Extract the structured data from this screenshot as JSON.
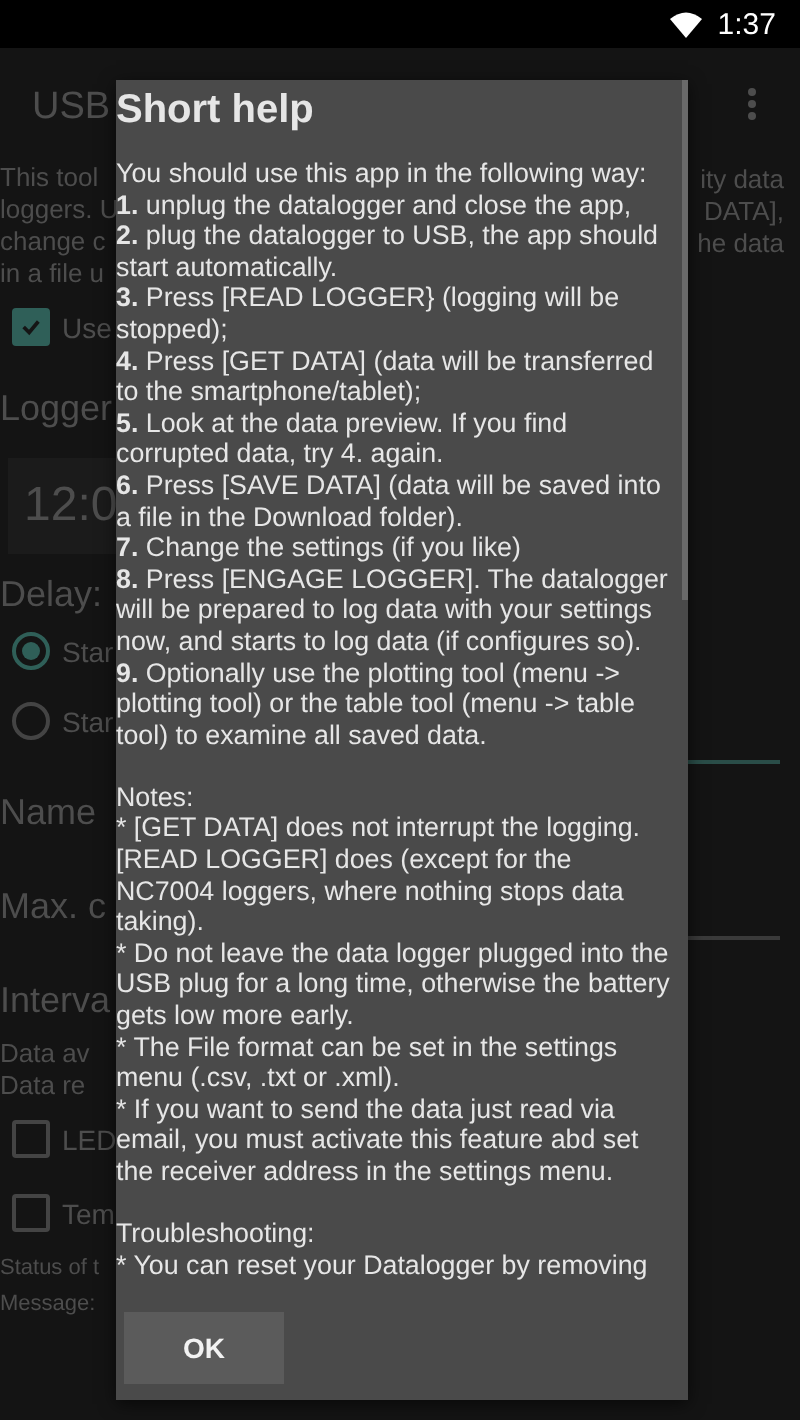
{
  "status_bar": {
    "time": "1:37"
  },
  "background": {
    "title": "USB",
    "left": [
      {
        "kind": "text",
        "text": "This tool"
      },
      {
        "kind": "text",
        "text": "loggers. U"
      },
      {
        "kind": "text",
        "text": "change c"
      },
      {
        "kind": "text",
        "text": "in a file u"
      },
      {
        "kind": "checkbox",
        "text": "Use",
        "checked": true
      },
      {
        "kind": "heading",
        "text": "Logger"
      },
      {
        "kind": "timefield",
        "text": "12:0"
      },
      {
        "kind": "heading",
        "text": "Delay:"
      },
      {
        "kind": "radio",
        "text": "Star",
        "selected": true
      },
      {
        "kind": "radio",
        "text": "Star",
        "selected": false
      },
      {
        "kind": "heading",
        "text": "Name"
      },
      {
        "kind": "heading",
        "text": "Max. c"
      },
      {
        "kind": "heading",
        "text": "Interva"
      },
      {
        "kind": "text",
        "text": "Data av"
      },
      {
        "kind": "text",
        "text": "Data re"
      },
      {
        "kind": "checkbox",
        "text": "LED",
        "checked": false
      },
      {
        "kind": "checkbox",
        "text": "Tem",
        "checked": false
      },
      {
        "kind": "small",
        "text": "Status of t"
      },
      {
        "kind": "small",
        "text": "Message:"
      }
    ],
    "right": [
      "ity data",
      "DATA],",
      "he data"
    ]
  },
  "dialog": {
    "title": "Short help",
    "intro": "You should use this app in the following way:",
    "steps": [
      "**1.** unplug the datalogger and close the app,",
      "**2.** plug the datalogger to USB, the app should start automatically.",
      "**3.** Press [READ LOGGER} (logging will be stopped);",
      "**4.** Press [GET DATA] (data will be transferred to the smartphone/tablet);",
      "**5.** Look at the data preview. If you find corrupted data, try 4. again.",
      "**6.** Press [SAVE DATA] (data will be saved into a file in the Download folder).",
      "**7.** Change the settings (if you like)",
      "**8.** Press [ENGAGE LOGGER]. The datalogger will be prepared to log data with your settings now, and starts to log data (if configures so).",
      "**9.** Optionally use the plotting tool (menu -> plotting tool) or the table tool (menu -> table tool) to examine all saved data."
    ],
    "notes_heading": "Notes:",
    "notes": [
      "* [GET DATA] does not interrupt the logging. [READ LOGGER] does (except for the NC7004 loggers, where nothing stops data taking).",
      "* Do not leave the data logger plugged into the USB plug for a long time, otherwise the battery gets low more early.",
      "* The File format can be set in the settings menu (.csv, .txt or .xml).",
      "* If you want to send the data just read via email, you must activate this feature abd set the receiver address in the settings menu."
    ],
    "trouble_heading": "Troubleshooting:",
    "trouble": [
      "* You can reset your Datalogger by removing"
    ],
    "button": "OK"
  }
}
